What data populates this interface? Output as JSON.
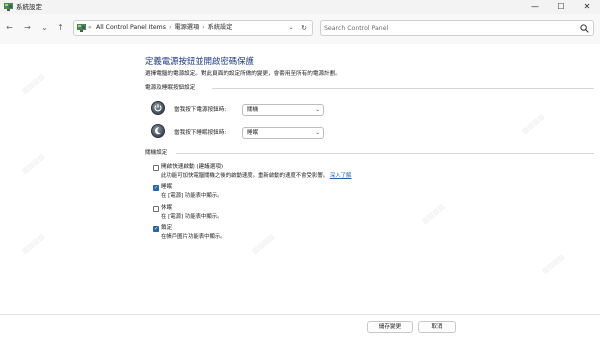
{
  "window": {
    "title": "系統設定",
    "controls": {
      "minimize": "—",
      "maximize": "☐",
      "close": "✕"
    }
  },
  "nav": {
    "back": "←",
    "forward": "→",
    "recent": "⌄",
    "up": "↑",
    "address_prefix": "«",
    "breadcrumbs": [
      "All Control Panel Items",
      "電源選項",
      "系統設定"
    ],
    "dropdown": "⌄",
    "refresh": "↻",
    "search_placeholder": "Search Control Panel"
  },
  "content": {
    "heading": "定義電源按鈕並開啟密碼保護",
    "intro": "選擇電腦的電源設定。對此頁面的設定所做的變更，會套用至所有的電源計劃。",
    "power_section_label": "電源及睡眠按鈕設定",
    "power_rows": [
      {
        "label": "當我按下電源按鈕時:",
        "value": "關機",
        "icon": "power-button-icon"
      },
      {
        "label": "當我按下睡眠按鈕時:",
        "value": "睡眠",
        "icon": "sleep-button-icon"
      }
    ],
    "shutdown_section_label": "關機設定",
    "shutdown_options": [
      {
        "label": "開啟快速啟動 (建議選項)",
        "checked": false,
        "desc": "此功能可加快電腦關機之後的啟動速度。重新啟動的速度不會受影響。",
        "link": "深入了解"
      },
      {
        "label": "睡眠",
        "checked": true,
        "desc": "在 [電源] 功能表中顯示。"
      },
      {
        "label": "休眠",
        "checked": false,
        "desc": "在 [電源] 功能表中顯示。"
      },
      {
        "label": "鎖定",
        "checked": true,
        "desc": "在帳戶圖片功能表中顯示。"
      }
    ],
    "check_glyph": "✓"
  },
  "footer": {
    "save_label": "儲存變更",
    "cancel_label": "取消"
  },
  "colors": {
    "heading": "#1e3a8a",
    "checkbox_accent": "#2563b0",
    "link": "#1a5fb4"
  }
}
